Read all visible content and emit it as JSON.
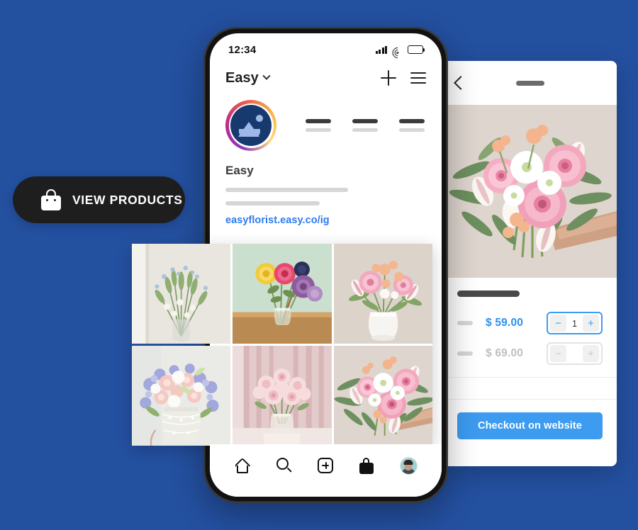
{
  "theme": {
    "background": "#2450A0",
    "accent_blue": "#3D9BF0",
    "link_blue": "#2E7BEF",
    "dark_pill": "#1E1E1E"
  },
  "cta": {
    "label": "VIEW PRODUCTS",
    "icon": "shopping-bag-icon"
  },
  "phone": {
    "status_bar": {
      "time": "12:34",
      "icons": [
        "cellular-signal-icon",
        "wifi-icon",
        "battery-icon"
      ]
    },
    "app_header": {
      "account_name": "Easy",
      "caret_icon": "chevron-down-icon",
      "actions": [
        {
          "icon": "plus-icon"
        },
        {
          "icon": "hamburger-menu-icon"
        }
      ]
    },
    "profile": {
      "avatar_icon": "profile-photo-placeholder-icon",
      "stats": [
        {
          "value_placeholder": "",
          "label_placeholder": ""
        },
        {
          "value_placeholder": "",
          "label_placeholder": ""
        },
        {
          "value_placeholder": "",
          "label_placeholder": ""
        }
      ],
      "display_name": "Easy",
      "bio_line_1": "",
      "bio_line_2": "",
      "link": "easyflorist.easy.co/ig"
    },
    "grid": [
      {
        "alt": "blue-and-white-wildflowers-in-clear-vase-by-window"
      },
      {
        "alt": "yellow-pink-and-purple-flowers-in-jar-on-wooden-table"
      },
      {
        "alt": "pink-gerbera-and-tulips-in-white-ceramic-vase"
      },
      {
        "alt": "pastel-lilac-and-peach-bouquet-in-lace-wrapped-jar"
      },
      {
        "alt": "blush-roses-in-glass-jar-against-pink-curtain"
      },
      {
        "alt": "pink-gerbera-bouquet-with-eucalyptus-held-in-hand"
      }
    ],
    "bottom_nav": [
      {
        "icon": "home-icon",
        "label": "Home"
      },
      {
        "icon": "search-icon",
        "label": "Search"
      },
      {
        "icon": "add-post-icon",
        "label": "Create"
      },
      {
        "icon": "shopping-bag-icon",
        "label": "Shop"
      },
      {
        "icon": "profile-avatar-icon",
        "label": "Profile"
      }
    ]
  },
  "product_panel": {
    "back_icon": "chevron-left-icon",
    "title_placeholder": "",
    "photo_alt": "pink-gerbera-and-tulip-bouquet-held-in-hand",
    "product_name_placeholder": "",
    "variants": [
      {
        "swatch_placeholder": "",
        "price": "$ 59.00",
        "state": "selected",
        "stepper": {
          "minus_label": "−",
          "quantity": "1",
          "plus_label": "+"
        }
      },
      {
        "swatch_placeholder": "",
        "price": "$ 69.00",
        "state": "disabled",
        "stepper": {
          "minus_label": "−",
          "quantity": "",
          "plus_label": "+"
        }
      }
    ],
    "checkout_label": "Checkout on website"
  }
}
